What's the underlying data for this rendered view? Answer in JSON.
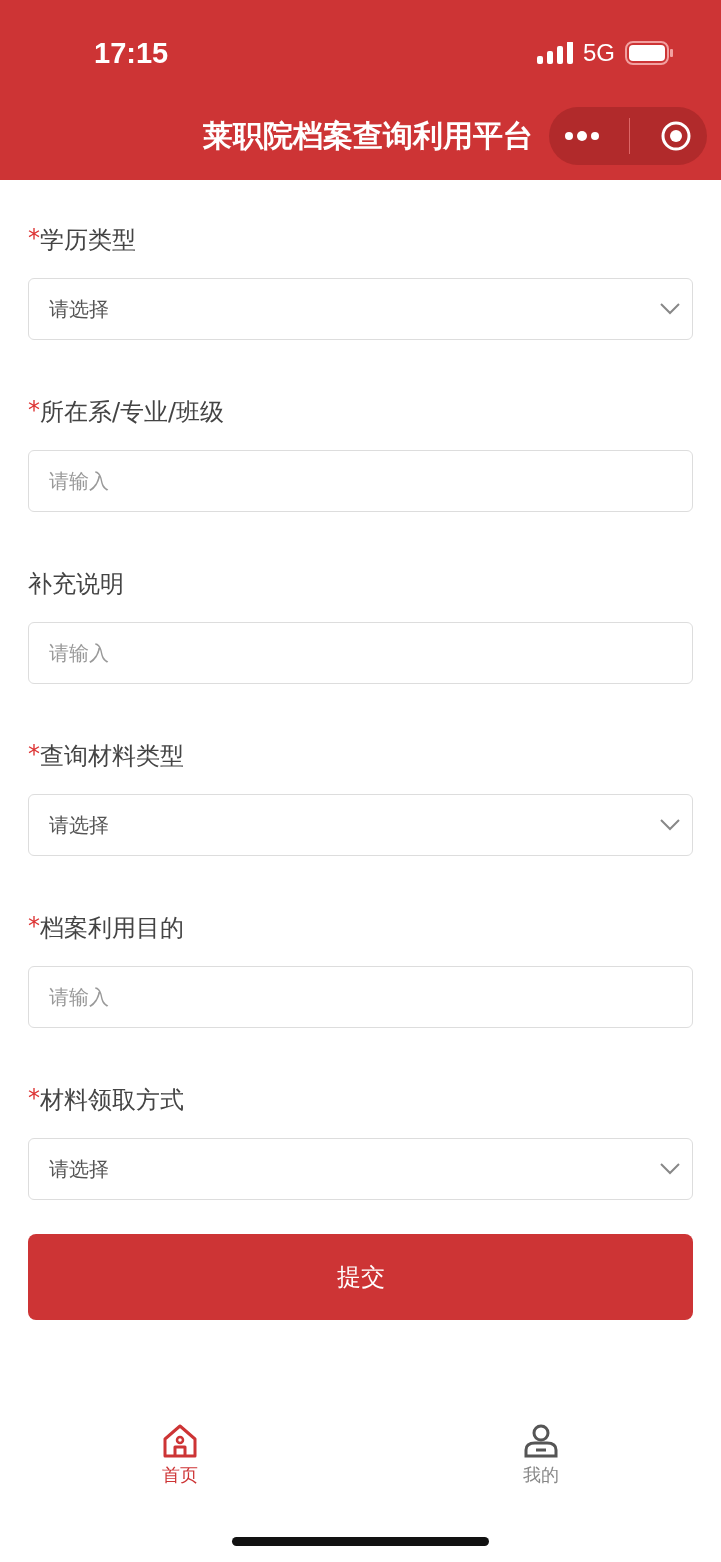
{
  "status_bar": {
    "time": "17:15",
    "network": "5G"
  },
  "header": {
    "title": "莱职院档案查询利用平台"
  },
  "fields": [
    {
      "label": "学历类型",
      "required": true,
      "kind": "select",
      "placeholder": "请选择"
    },
    {
      "label": "所在系/专业/班级",
      "required": true,
      "kind": "input",
      "placeholder": "请输入"
    },
    {
      "label": "补充说明",
      "required": false,
      "kind": "input",
      "placeholder": "请输入"
    },
    {
      "label": "查询材料类型",
      "required": true,
      "kind": "select",
      "placeholder": "请选择"
    },
    {
      "label": "档案利用目的",
      "required": true,
      "kind": "input",
      "placeholder": "请输入"
    },
    {
      "label": "材料领取方式",
      "required": true,
      "kind": "select",
      "placeholder": "请选择"
    }
  ],
  "required_mark": "*",
  "submit": "提交",
  "tabs": [
    {
      "label": "首页",
      "selected": true,
      "kind": "home"
    },
    {
      "label": "我的",
      "selected": false,
      "kind": "user"
    }
  ]
}
